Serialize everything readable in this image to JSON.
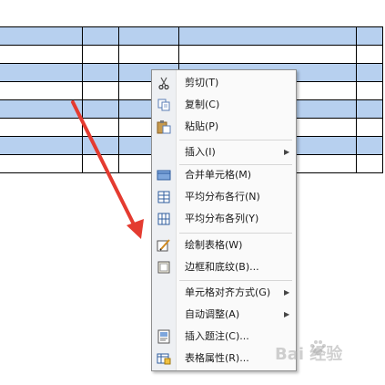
{
  "colors": {
    "table_shading": "#b7d0ef",
    "arrow": "#e43b30",
    "menu_bg": "#fafafa",
    "menu_gutter": "#eef0f3"
  },
  "context_menu": {
    "items": [
      {
        "label": "剪切(T)",
        "icon": "scissors-icon",
        "submenu": false
      },
      {
        "label": "复制(C)",
        "icon": "copy-icon",
        "submenu": false
      },
      {
        "label": "粘贴(P)",
        "icon": "paste-icon",
        "submenu": false
      },
      {
        "label": "插入(I)",
        "icon": "",
        "submenu": true
      },
      {
        "label": "合并单元格(M)",
        "icon": "merge-cells-icon",
        "submenu": false
      },
      {
        "label": "平均分布各行(N)",
        "icon": "distribute-rows-icon",
        "submenu": false
      },
      {
        "label": "平均分布各列(Y)",
        "icon": "distribute-columns-icon",
        "submenu": false
      },
      {
        "label": "绘制表格(W)",
        "icon": "draw-table-icon",
        "submenu": false
      },
      {
        "label": "边框和底纹(B)...",
        "icon": "borders-shading-icon",
        "submenu": false
      },
      {
        "label": "单元格对齐方式(G)",
        "icon": "",
        "submenu": true
      },
      {
        "label": "自动调整(A)",
        "icon": "",
        "submenu": true
      },
      {
        "label": "插入题注(C)...",
        "icon": "insert-caption-icon",
        "submenu": false
      },
      {
        "label": "表格属性(R)...",
        "icon": "table-properties-icon",
        "submenu": false
      }
    ],
    "submenu_arrow": "▶"
  },
  "watermark": {
    "text": "Bai   经验"
  }
}
